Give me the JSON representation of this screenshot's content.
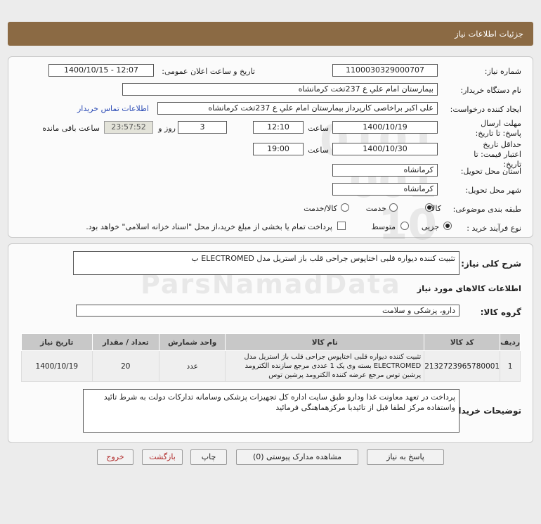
{
  "header": {
    "title": "جزئیات اطلاعات نیاز"
  },
  "form": {
    "need_no_label": "شماره نیاز:",
    "need_no": "1100030329000707",
    "announce_label": "تاریخ و ساعت اعلان عمومی:",
    "announce_value": "1400/10/15 - 12:07",
    "buyer_label": "نام دستگاه خریدار:",
    "buyer_value": "بیمارستان امام علي ع 237تخت کرمانشاه",
    "creator_label": "ایجاد کننده درخواست:",
    "creator_value": "علی اکبر براخاصی کارپرداز بیمارستان امام علي ع 237تخت کرمانشاه",
    "contact_link": "اطلاعات تماس خریدار",
    "deadline_label": "مهلت ارسال پاسخ: تا تاریخ:",
    "deadline_date": "1400/10/19",
    "time_label": "ساعت",
    "deadline_time": "12:10",
    "days_value": "3",
    "days_label": "روز و",
    "remaining_value": "23:57:52",
    "remaining_label": "ساعت باقی مانده",
    "validity_label": "حداقل تاریخ اعتبار قیمت: تا تاریخ:",
    "validity_date": "1400/10/30",
    "validity_time_label": "ساعت",
    "validity_time": "19:00",
    "province_label": "استان محل تحویل:",
    "province_value": "کرمانشاه",
    "city_label": "شهر محل تحویل:",
    "city_value": "کرمانشاه",
    "category_label": "طبقه بندی موضوعی:",
    "category_options": [
      "کالا",
      "خدمت",
      "کالا/خدمت"
    ],
    "process_label": "نوع فرآیند خرید :",
    "process_options": [
      "جزیی",
      "متوسط"
    ],
    "payment_note": "پرداخت تمام یا بخشی از مبلغ خرید،از محل \"اسناد خزانه اسلامی\" خواهد بود."
  },
  "summary": {
    "label": "شرح کلی نیاز:",
    "value": "تثبیت کننده دیواره قلبی اختاپوس جراحی قلب باز استریل مدل ELECTROMED ب"
  },
  "goods": {
    "section_title": "اطلاعات کالاهای مورد نیاز",
    "group_label": "گروه کالا:",
    "group_value": "دارو، پزشکی و سلامت"
  },
  "table": {
    "headers": [
      "ردیف",
      "کد کالا",
      "نام کالا",
      "واحد شمارش",
      "تعداد / مقدار",
      "تاریخ نیاز"
    ],
    "rows": [
      {
        "index": "1",
        "code": "2132723965780001",
        "name": "تثبیت کننده دیواره قلبی اختاپوس جراحی قلب باز استریل مدل ELECTROMED بسته وی پک 1 عددی مرجع سازنده الکترومد پرشین توس مرجع عرضه کننده الکترومد پرشین توس",
        "unit": "عدد",
        "qty": "20",
        "date": "1400/10/19"
      }
    ]
  },
  "buyer_notes": {
    "label": "توضیحات خریدار:",
    "value": "پرداخت در تعهد معاونت غذا ودارو طبق سایت اداره کل تجهیزات پزشکی وسامانه تدارکات دولت به شرط تائید واستفاده مرکز لطفا قبل از تائیدبا مرکزهماهنگی فرمائید"
  },
  "buttons": {
    "reply": "پاسخ به نیاز",
    "docs": "مشاهده مدارک پیوستی (0)",
    "print": "چاپ",
    "back": "بازگشت",
    "exit": "خروج"
  }
}
